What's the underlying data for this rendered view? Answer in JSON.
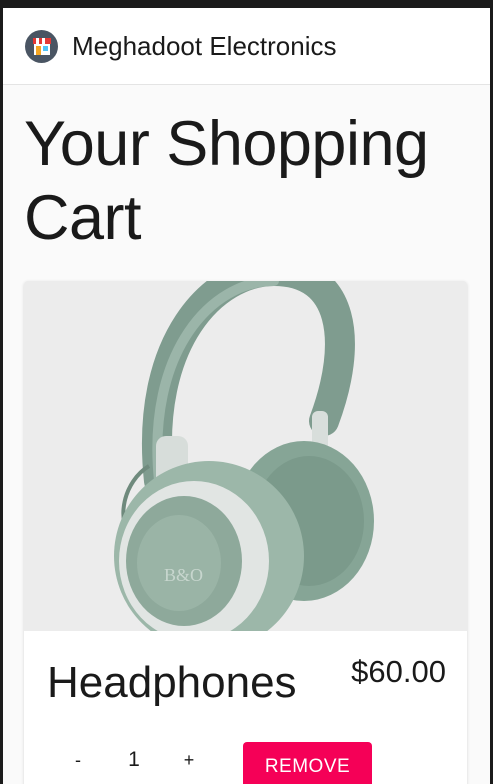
{
  "appbar": {
    "brand": "Meghadoot Electronics",
    "logo_icon": "storefront-icon"
  },
  "page": {
    "title": "Your Shopping Cart"
  },
  "cart": {
    "items": [
      {
        "name": "Headphones",
        "price": "$60.00",
        "quantity": "1",
        "decrement_label": "-",
        "increment_label": "+",
        "remove_label": "REMOVE",
        "image_icon": "headphones-image"
      }
    ]
  },
  "colors": {
    "accent": "#f50057",
    "appbar_bg": "#ffffff",
    "page_bg": "#fafafa",
    "headphone_green": "#8aa89a"
  }
}
